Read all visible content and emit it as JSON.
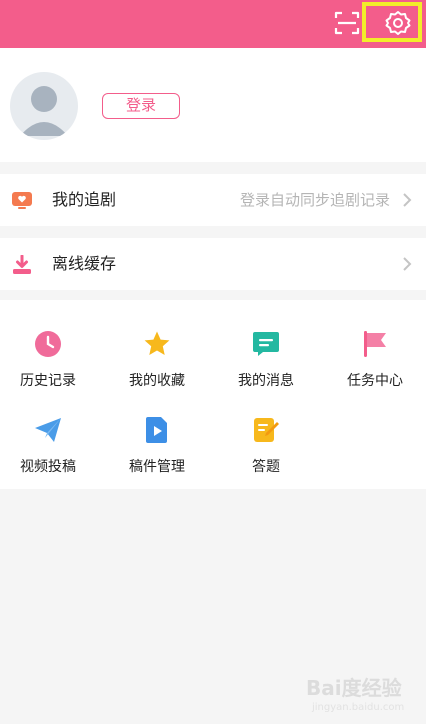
{
  "header": {
    "scan_icon": "scan-icon",
    "settings_icon": "gear-icon",
    "colors": {
      "brand": "#f35d8b",
      "highlight": "#f2ee2a",
      "arrow": "#ff2b3c"
    }
  },
  "profile": {
    "avatar_icon": "default-avatar-icon",
    "login_label": "登录"
  },
  "menu": {
    "drama": {
      "icon": "tv-heart-icon",
      "title": "我的追剧",
      "hint": "登录自动同步追剧记录"
    },
    "offline": {
      "icon": "download-icon",
      "title": "离线缓存"
    }
  },
  "grid": {
    "items": [
      {
        "label": "历史记录",
        "icon": "clock-icon"
      },
      {
        "label": "我的收藏",
        "icon": "star-icon"
      },
      {
        "label": "我的消息",
        "icon": "message-icon"
      },
      {
        "label": "任务中心",
        "icon": "flag-icon"
      },
      {
        "label": "视频投稿",
        "icon": "paper-plane-icon"
      },
      {
        "label": "稿件管理",
        "icon": "video-file-icon"
      },
      {
        "label": "答题",
        "icon": "quiz-pencil-icon"
      }
    ]
  },
  "watermark": {
    "logo": "Bai度经验",
    "url": "jingyan.baidu.com"
  }
}
